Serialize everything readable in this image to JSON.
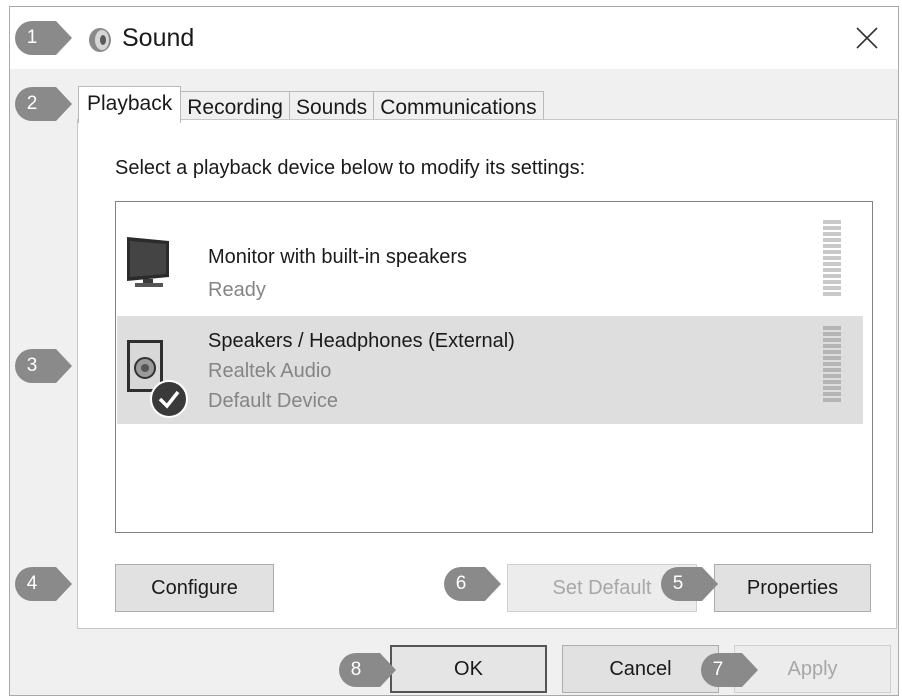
{
  "window": {
    "title": "Sound",
    "close_icon": "close-icon",
    "speaker_icon": "speaker-icon"
  },
  "tabs": [
    {
      "label": "Playback",
      "active": true
    },
    {
      "label": "Recording",
      "active": false
    },
    {
      "label": "Sounds",
      "active": false
    },
    {
      "label": "Communications",
      "active": false
    }
  ],
  "panel": {
    "instruction": "Select a playback device below to modify its settings:"
  },
  "devices": [
    {
      "name": "Monitor with built-in speakers",
      "details": [
        "Ready"
      ],
      "icon": "monitor-icon",
      "selected": false
    },
    {
      "name": "Speakers / Headphones (External)",
      "details": [
        "Realtek Audio",
        "Default Device"
      ],
      "icon": "speaker-icon",
      "badge": "checkmark-icon",
      "selected": true
    }
  ],
  "buttons": {
    "configure": "Configure",
    "set_default": "Set Default",
    "properties": "Properties",
    "ok": "OK",
    "cancel": "Cancel",
    "apply": "Apply"
  },
  "callouts": [
    "1",
    "2",
    "3",
    "4",
    "5",
    "6",
    "7",
    "8"
  ],
  "colors": {
    "callout": "#8a8a8a",
    "selection": "#dedede",
    "disabled_text": "#a7a7a7"
  }
}
